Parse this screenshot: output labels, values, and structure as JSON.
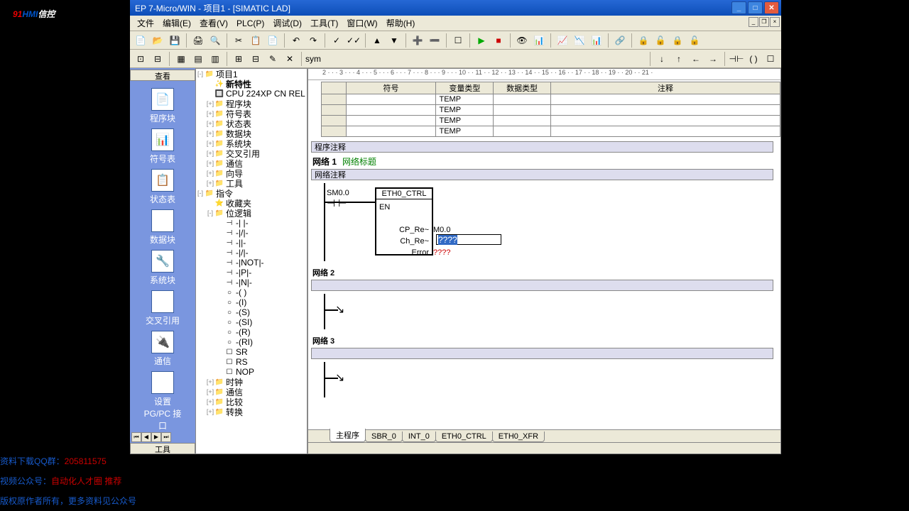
{
  "title": "EP 7-Micro/WIN - 项目1 - [SIMATIC LAD]",
  "menus": [
    "文件",
    "编辑(E)",
    "查看(V)",
    "PLC(P)",
    "调试(D)",
    "工具(T)",
    "窗口(W)",
    "帮助(H)"
  ],
  "nav": {
    "header": "查看",
    "footer": "工具",
    "items": [
      {
        "ico": "📄",
        "label": "程序块"
      },
      {
        "ico": "📊",
        "label": "符号表"
      },
      {
        "ico": "📋",
        "label": "状态表"
      },
      {
        "ico": "🗄",
        "label": "数据块"
      },
      {
        "ico": "🔧",
        "label": "系统块"
      },
      {
        "ico": "↔",
        "label": "交叉引用"
      },
      {
        "ico": "🔌",
        "label": "通信"
      },
      {
        "ico": "⚙",
        "label": "设置 PG/PC 接口"
      }
    ]
  },
  "tree": [
    {
      "d": 0,
      "e": "-",
      "i": "📁",
      "t": "项目1"
    },
    {
      "d": 1,
      "e": "",
      "i": "✨",
      "t": "新特性",
      "bold": true
    },
    {
      "d": 1,
      "e": "",
      "i": "🔲",
      "t": "CPU 224XP CN REL"
    },
    {
      "d": 1,
      "e": "+",
      "i": "📁",
      "t": "程序块"
    },
    {
      "d": 1,
      "e": "+",
      "i": "📁",
      "t": "符号表"
    },
    {
      "d": 1,
      "e": "+",
      "i": "📁",
      "t": "状态表"
    },
    {
      "d": 1,
      "e": "+",
      "i": "📁",
      "t": "数据块"
    },
    {
      "d": 1,
      "e": "+",
      "i": "📁",
      "t": "系统块"
    },
    {
      "d": 1,
      "e": "+",
      "i": "📁",
      "t": "交叉引用"
    },
    {
      "d": 1,
      "e": "+",
      "i": "📁",
      "t": "通信"
    },
    {
      "d": 1,
      "e": "+",
      "i": "📁",
      "t": "向导"
    },
    {
      "d": 1,
      "e": "+",
      "i": "📁",
      "t": "工具"
    },
    {
      "d": 0,
      "e": "-",
      "i": "📁",
      "t": "指令"
    },
    {
      "d": 1,
      "e": "",
      "i": "⭐",
      "t": "收藏夹"
    },
    {
      "d": 1,
      "e": "-",
      "i": "📁",
      "t": "位逻辑"
    },
    {
      "d": 2,
      "e": "",
      "i": "⊣",
      "t": "-| |-"
    },
    {
      "d": 2,
      "e": "",
      "i": "⊣",
      "t": "-|/|-"
    },
    {
      "d": 2,
      "e": "",
      "i": "⊣",
      "t": "-||-"
    },
    {
      "d": 2,
      "e": "",
      "i": "⊣",
      "t": "-|/|-"
    },
    {
      "d": 2,
      "e": "",
      "i": "⊣",
      "t": "-|NOT|-"
    },
    {
      "d": 2,
      "e": "",
      "i": "⊣",
      "t": "-|P|-"
    },
    {
      "d": 2,
      "e": "",
      "i": "⊣",
      "t": "-|N|-"
    },
    {
      "d": 2,
      "e": "",
      "i": "○",
      "t": "-( )"
    },
    {
      "d": 2,
      "e": "",
      "i": "○",
      "t": "-(I)"
    },
    {
      "d": 2,
      "e": "",
      "i": "○",
      "t": "-(S)"
    },
    {
      "d": 2,
      "e": "",
      "i": "○",
      "t": "-(SI)"
    },
    {
      "d": 2,
      "e": "",
      "i": "○",
      "t": "-(R)"
    },
    {
      "d": 2,
      "e": "",
      "i": "○",
      "t": "-(RI)"
    },
    {
      "d": 2,
      "e": "",
      "i": "☐",
      "t": "SR"
    },
    {
      "d": 2,
      "e": "",
      "i": "☐",
      "t": "RS"
    },
    {
      "d": 2,
      "e": "",
      "i": "☐",
      "t": "NOP"
    },
    {
      "d": 1,
      "e": "+",
      "i": "📁",
      "t": "时钟"
    },
    {
      "d": 1,
      "e": "+",
      "i": "📁",
      "t": "通信"
    },
    {
      "d": 1,
      "e": "+",
      "i": "📁",
      "t": "比较"
    },
    {
      "d": 1,
      "e": "+",
      "i": "📁",
      "t": "转换"
    }
  ],
  "vartable": {
    "headers": [
      "符号",
      "变量类型",
      "数据类型",
      "注释"
    ],
    "rows": [
      [
        "",
        "TEMP",
        "",
        ""
      ],
      [
        "",
        "TEMP",
        "",
        ""
      ],
      [
        "",
        "TEMP",
        "",
        ""
      ],
      [
        "",
        "TEMP",
        "",
        ""
      ]
    ]
  },
  "lad": {
    "progcmt": "程序注释",
    "net1": {
      "label": "网络 1",
      "title": "网络标题",
      "cmt": "网络注释",
      "contact": "SM0.0",
      "block": {
        "name": "ETH0_CTRL",
        "en": "EN",
        "pins": [
          {
            "n": "CP_Re~",
            "v": "M0.0"
          },
          {
            "n": "Ch_Re~",
            "v": "????",
            "edit": true
          },
          {
            "n": "Error",
            "v": "????"
          }
        ]
      }
    },
    "net2": {
      "label": "网络 2"
    },
    "net3": {
      "label": "网络 3"
    }
  },
  "tabs": [
    "主程序",
    "SBR_0",
    "INT_0",
    "ETH0_CTRL",
    "ETH0_XFR"
  ],
  "watermark": {
    "a": "91",
    "b": "HMI",
    "c": "信控"
  },
  "footer": {
    "l1a": "资料下载QQ群：",
    "l1b": "205811575",
    "l2a": "视频公众号：",
    "l2b": "自动化人才圈 推荐",
    "l3": "版权原作者所有，更多资料见公众号"
  }
}
